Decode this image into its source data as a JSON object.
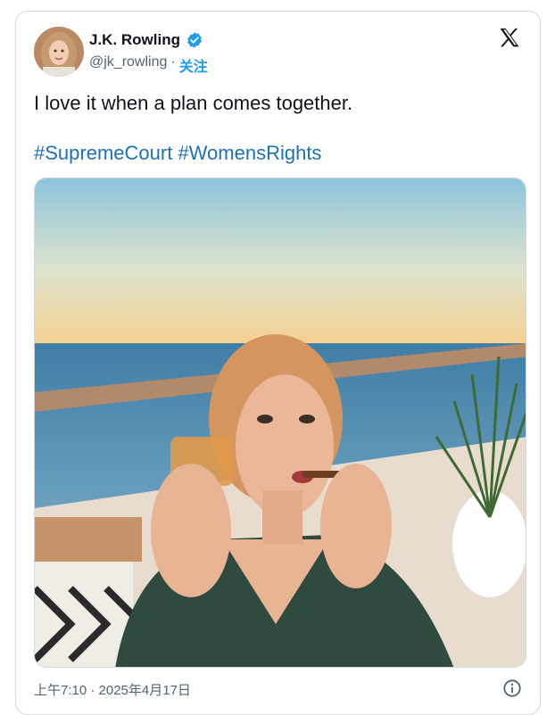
{
  "author": {
    "display_name": "J.K. Rowling",
    "handle": "@jk_rowling",
    "separator": "·",
    "follow_label": "关注",
    "verified_color": "#1d9bf0"
  },
  "tweet": {
    "text": "I love it when a plan comes together.",
    "hashtags": [
      "#SupremeCourt",
      "#WomensRights"
    ]
  },
  "meta": {
    "timestamp": "上午7:10 · 2025年4月17日"
  },
  "icons": {
    "brand": "x-logo-icon",
    "info": "info-icon",
    "verified": "verified-badge-icon"
  },
  "colors": {
    "link": "#1d71b8",
    "accent": "#1d9bf0",
    "muted": "#536471",
    "border": "#cfd9de"
  }
}
